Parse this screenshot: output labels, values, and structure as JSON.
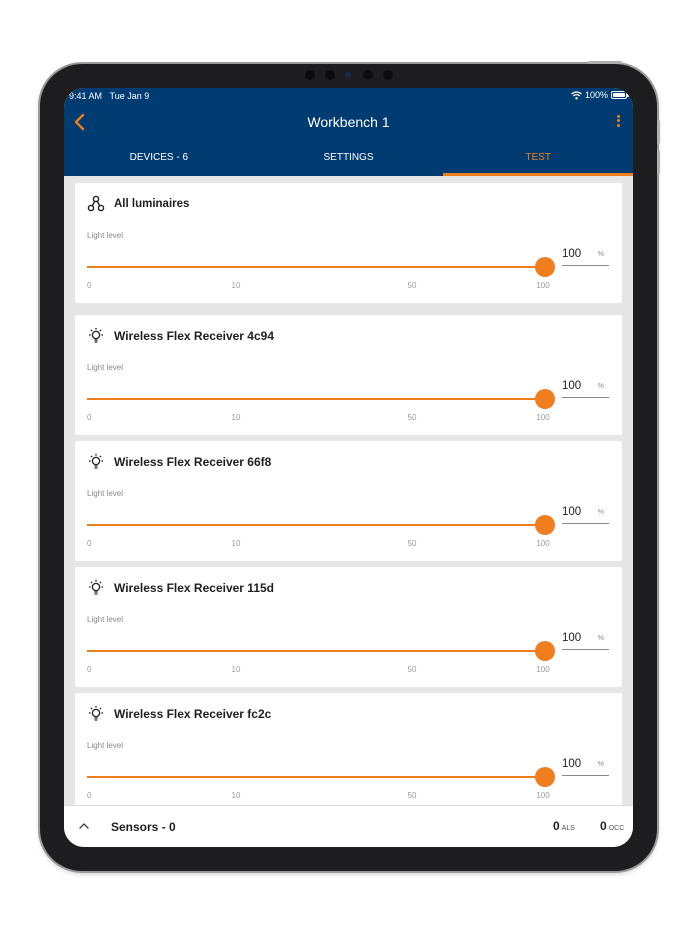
{
  "status_bar": {
    "time": "9:41 AM",
    "date": "Tue Jan 9",
    "battery": "100%"
  },
  "header": {
    "title": "Workbench 1",
    "back_icon": "chevron-left-icon",
    "more_icon": "more-vertical-icon"
  },
  "tabs": [
    {
      "label": "DEVICES - 6",
      "active": false
    },
    {
      "label": "SETTINGS",
      "active": false
    },
    {
      "label": "TEST",
      "active": true
    }
  ],
  "cards": [
    {
      "title": "All luminaires",
      "icon": "group-nodes-icon",
      "light_label": "Light level",
      "value": "100",
      "unit": "%",
      "level": 1.0,
      "ticks": [
        "0",
        "10",
        "50",
        "100"
      ]
    },
    {
      "title": "Wireless Flex Receiver 4c94",
      "icon": "lightbulb-icon",
      "light_label": "Light level",
      "value": "100",
      "unit": "%",
      "level": 1.0,
      "ticks": [
        "0",
        "10",
        "50",
        "100"
      ]
    },
    {
      "title": "Wireless Flex Receiver 66f8",
      "icon": "lightbulb-icon",
      "light_label": "Light level",
      "value": "100",
      "unit": "%",
      "level": 1.0,
      "ticks": [
        "0",
        "10",
        "50",
        "100"
      ]
    },
    {
      "title": "Wireless Flex Receiver 115d",
      "icon": "lightbulb-icon",
      "light_label": "Light level",
      "value": "100",
      "unit": "%",
      "level": 1.0,
      "ticks": [
        "0",
        "10",
        "50",
        "100"
      ]
    },
    {
      "title": "Wireless Flex Receiver fc2c",
      "icon": "lightbulb-icon",
      "light_label": "Light level",
      "value": "100",
      "unit": "%",
      "level": 1.0,
      "ticks": [
        "0",
        "10",
        "50",
        "100"
      ]
    }
  ],
  "footer": {
    "sensors_label": "Sensors - 0",
    "als_count": "0",
    "als_label": "ALS",
    "occ_count": "0",
    "occ_label": "OCC"
  },
  "colors": {
    "header": "#003c71",
    "accent": "#f07d1e",
    "background": "#e6e6e6"
  }
}
